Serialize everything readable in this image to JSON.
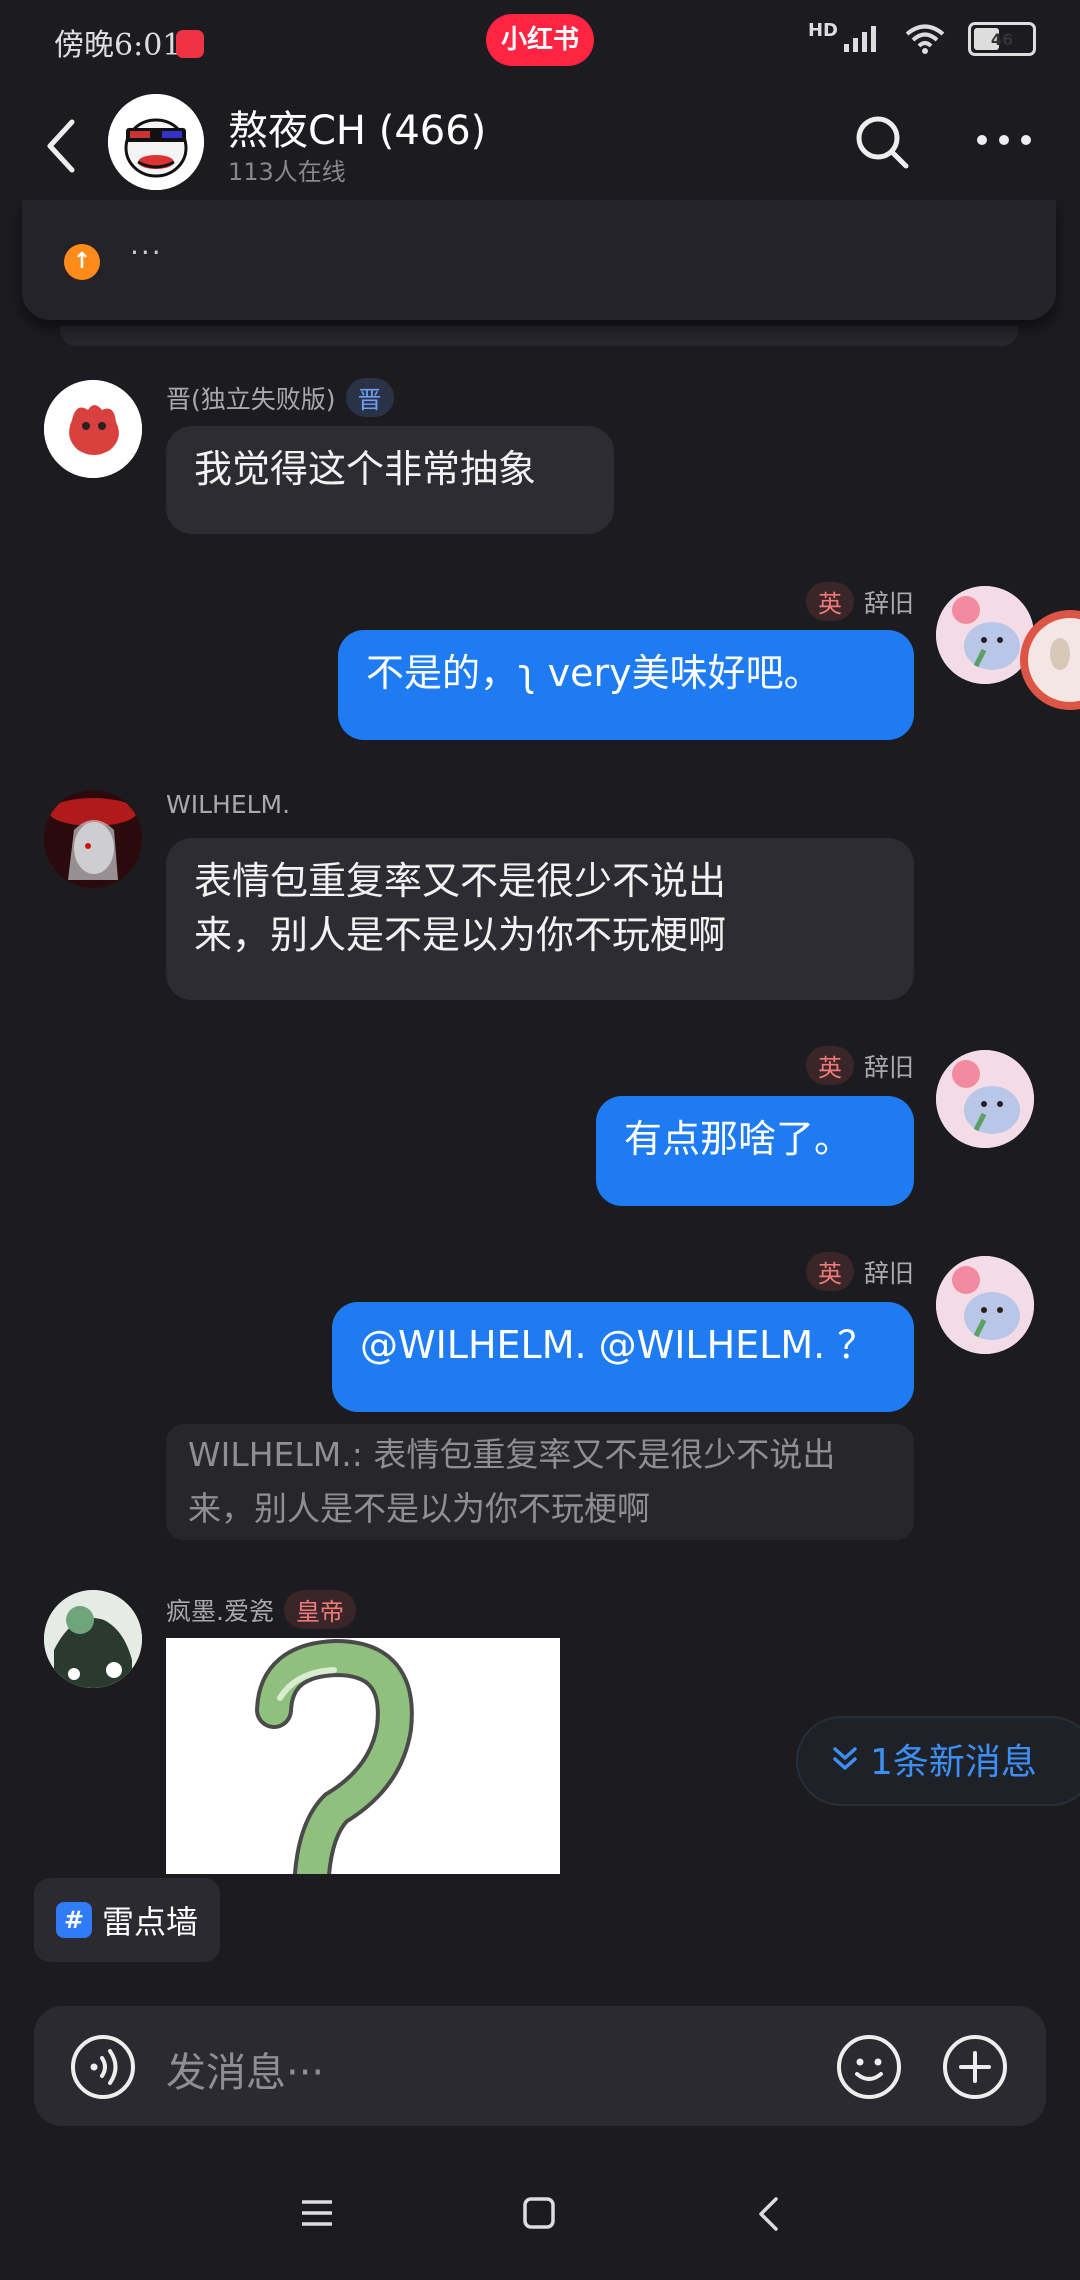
{
  "status_bar": {
    "time": "傍晚6:01",
    "app_badge": "小红书",
    "network": "HD",
    "battery": "46"
  },
  "header": {
    "title": "熬夜CH (466)",
    "subtitle": "113人在线"
  },
  "pinned": {
    "dots": "···"
  },
  "messages": [
    {
      "sender": "晋(独立失败版)",
      "badge": "晋",
      "text": "我觉得这个非常抽象"
    },
    {
      "sender": "辞旧",
      "badge": "英",
      "text": "不是的，ʅ very美味好吧。"
    },
    {
      "sender": "WILHELM.",
      "text_line1": "表情包重复率又不是很少不说出",
      "text_line2": "来，别人是不是以为你不玩梗啊"
    },
    {
      "sender": "辞旧",
      "badge": "英",
      "text": "有点那啥了。"
    },
    {
      "sender": "辞旧",
      "badge": "英",
      "text": "@WILHELM. @WILHELM. ？",
      "quote_line1": "WILHELM.: 表情包重复率又不是很少不说出",
      "quote_line2": "来，别人是不是以为你不玩梗啊"
    },
    {
      "sender": "疯墨.爱瓷",
      "badge": "皇帝"
    }
  ],
  "new_messages": "1条新消息",
  "topic_tag": "雷点墙",
  "input": {
    "placeholder": "发消息···"
  },
  "icons": [
    "back-icon",
    "search-icon",
    "more-icon",
    "voice-icon",
    "emoji-icon",
    "plus-icon",
    "menu-icon",
    "home-icon",
    "nav-back-icon"
  ],
  "colors": {
    "background": "#1b1b20",
    "self_bubble": "#1f7bf2",
    "other_bubble": "#2c2c32",
    "accent_blue": "#3d8ff5",
    "brand_red": "#ff2442"
  }
}
